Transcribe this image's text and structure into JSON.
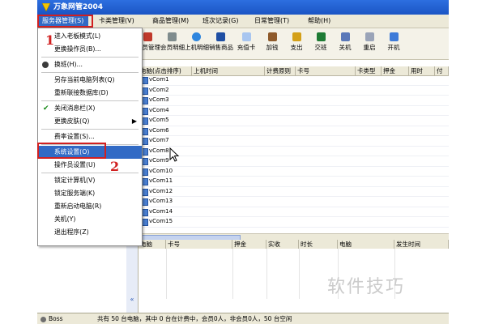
{
  "window": {
    "title": "万象网管2004"
  },
  "menubar": {
    "items": [
      {
        "label": "服务器管理(S)",
        "active": true
      },
      {
        "label": "卡类管理(V)"
      },
      {
        "label": "商品管理(M)"
      },
      {
        "label": "班次记录(G)"
      },
      {
        "label": "日常管理(T)"
      },
      {
        "label": "帮助(H)"
      }
    ]
  },
  "toolbar": {
    "buttons": [
      {
        "label": "会员管理",
        "icon": "members-icon"
      },
      {
        "label": "会员明细",
        "icon": "member-detail-icon"
      },
      {
        "label": "上机明细",
        "icon": "session-detail-icon"
      },
      {
        "label": "销售商品",
        "icon": "sell-goods-icon"
      },
      {
        "label": "充值卡",
        "icon": "recharge-card-icon"
      },
      {
        "label": "加钱",
        "icon": "add-money-icon"
      },
      {
        "label": "支出",
        "icon": "expense-icon"
      },
      {
        "label": "交班",
        "icon": "shift-change-icon"
      },
      {
        "label": "关机",
        "icon": "shutdown-icon"
      },
      {
        "label": "重启",
        "icon": "restart-icon"
      },
      {
        "label": "开机",
        "icon": "power-on-icon"
      }
    ]
  },
  "dropdown": {
    "items": [
      {
        "label": "进入老板模式(L)"
      },
      {
        "label": "更换操作员(B)..."
      },
      {
        "label": "换班(H)...",
        "icon": "user-icon"
      },
      {
        "label": "另存当前电脑列表(Q)"
      },
      {
        "label": "重新联接数据库(D)"
      },
      {
        "label": "关闭消息栏(X)",
        "checked": true
      },
      {
        "label": "更换皮肤(Q)",
        "submenu": true
      },
      {
        "label": "费率设置(S)..."
      },
      {
        "label": "系统设置(O)",
        "selected": true
      },
      {
        "label": "操作员设置(U)"
      },
      {
        "label": "锁定计算机(V)"
      },
      {
        "label": "锁定服务端(K)"
      },
      {
        "label": "重新启动电脑(R)"
      },
      {
        "label": "关机(Y)"
      },
      {
        "label": "退出程序(Z)"
      }
    ]
  },
  "computer_grid": {
    "headers": [
      "电脑(点击排序)",
      "上机时间",
      "计费原则",
      "卡号",
      "卡类型",
      "押金",
      "用时",
      "付"
    ],
    "rows": [
      "vCom1",
      "vCom2",
      "vCom3",
      "vCom4",
      "vCom5",
      "vCom6",
      "vCom7",
      "vCom8",
      "vCom9",
      "vCom10",
      "vCom11",
      "vCom12",
      "vCom13",
      "vCom14",
      "vCom15"
    ]
  },
  "log_grid": {
    "headers": [
      "电脑",
      "卡号",
      "押金",
      "实收",
      "时长",
      "电脑",
      "发生时间"
    ]
  },
  "status": {
    "user": "Boss",
    "message": "共有 50 台电脑，其中 0 台在计费中，会员0人，非会员0人，50 台空闲"
  },
  "annotations": {
    "marker1": "1",
    "marker2": "2"
  },
  "watermark": {
    "text": "软件技巧"
  },
  "colors": {
    "title_bar": "#1b55c4",
    "menu_active": "#316ac5",
    "annotation_red": "#d12020"
  }
}
